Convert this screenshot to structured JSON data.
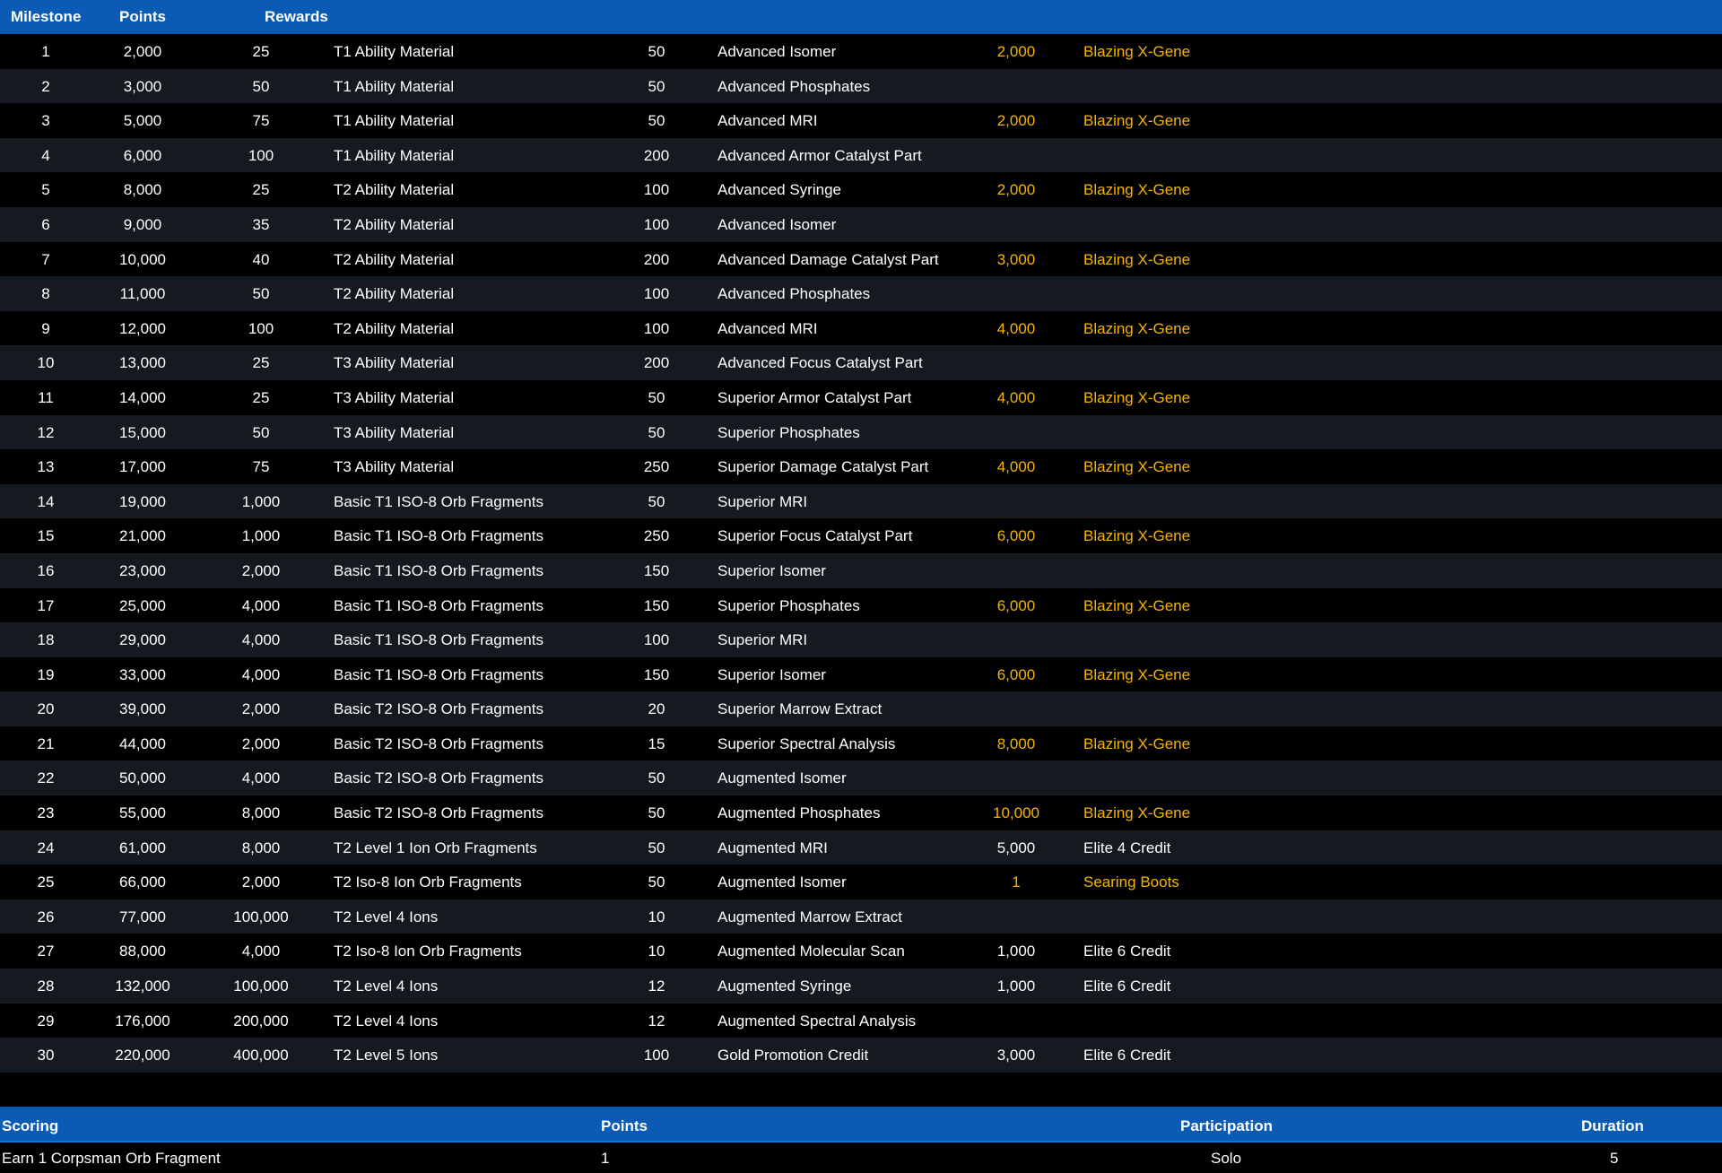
{
  "header": {
    "milestone": "Milestone",
    "points": "Points",
    "rewards": "Rewards"
  },
  "rows": [
    {
      "ms": "1",
      "pts": "2,000",
      "q1": "25",
      "n1": "T1 Ability Material",
      "q2": "50",
      "n2": "Advanced Isomer",
      "q3": "2,000",
      "n3": "Blazing X-Gene",
      "gold": true
    },
    {
      "ms": "2",
      "pts": "3,000",
      "q1": "50",
      "n1": "T1 Ability Material",
      "q2": "50",
      "n2": "Advanced Phosphates",
      "q3": "",
      "n3": "",
      "gold": false
    },
    {
      "ms": "3",
      "pts": "5,000",
      "q1": "75",
      "n1": "T1 Ability Material",
      "q2": "50",
      "n2": "Advanced MRI",
      "q3": "2,000",
      "n3": "Blazing X-Gene",
      "gold": true
    },
    {
      "ms": "4",
      "pts": "6,000",
      "q1": "100",
      "n1": "T1 Ability Material",
      "q2": "200",
      "n2": "Advanced Armor Catalyst Part",
      "q3": "",
      "n3": "",
      "gold": false
    },
    {
      "ms": "5",
      "pts": "8,000",
      "q1": "25",
      "n1": "T2 Ability Material",
      "q2": "100",
      "n2": "Advanced Syringe",
      "q3": "2,000",
      "n3": "Blazing X-Gene",
      "gold": true
    },
    {
      "ms": "6",
      "pts": "9,000",
      "q1": "35",
      "n1": "T2 Ability Material",
      "q2": "100",
      "n2": "Advanced Isomer",
      "q3": "",
      "n3": "",
      "gold": false
    },
    {
      "ms": "7",
      "pts": "10,000",
      "q1": "40",
      "n1": "T2 Ability Material",
      "q2": "200",
      "n2": "Advanced Damage Catalyst Part",
      "q3": "3,000",
      "n3": "Blazing X-Gene",
      "gold": true
    },
    {
      "ms": "8",
      "pts": "11,000",
      "q1": "50",
      "n1": "T2 Ability Material",
      "q2": "100",
      "n2": "Advanced Phosphates",
      "q3": "",
      "n3": "",
      "gold": false
    },
    {
      "ms": "9",
      "pts": "12,000",
      "q1": "100",
      "n1": "T2 Ability Material",
      "q2": "100",
      "n2": "Advanced MRI",
      "q3": "4,000",
      "n3": "Blazing X-Gene",
      "gold": true
    },
    {
      "ms": "10",
      "pts": "13,000",
      "q1": "25",
      "n1": "T3 Ability Material",
      "q2": "200",
      "n2": "Advanced Focus Catalyst Part",
      "q3": "",
      "n3": "",
      "gold": false
    },
    {
      "ms": "11",
      "pts": "14,000",
      "q1": "25",
      "n1": "T3 Ability Material",
      "q2": "50",
      "n2": "Superior Armor Catalyst Part",
      "q3": "4,000",
      "n3": "Blazing X-Gene",
      "gold": true
    },
    {
      "ms": "12",
      "pts": "15,000",
      "q1": "50",
      "n1": "T3 Ability Material",
      "q2": "50",
      "n2": "Superior Phosphates",
      "q3": "",
      "n3": "",
      "gold": false
    },
    {
      "ms": "13",
      "pts": "17,000",
      "q1": "75",
      "n1": "T3 Ability Material",
      "q2": "250",
      "n2": "Superior Damage Catalyst Part",
      "q3": "4,000",
      "n3": "Blazing X-Gene",
      "gold": true
    },
    {
      "ms": "14",
      "pts": "19,000",
      "q1": "1,000",
      "n1": "Basic T1 ISO-8 Orb Fragments",
      "q2": "50",
      "n2": "Superior MRI",
      "q3": "",
      "n3": "",
      "gold": false
    },
    {
      "ms": "15",
      "pts": "21,000",
      "q1": "1,000",
      "n1": "Basic T1 ISO-8 Orb Fragments",
      "q2": "250",
      "n2": "Superior Focus Catalyst Part",
      "q3": "6,000",
      "n3": "Blazing X-Gene",
      "gold": true
    },
    {
      "ms": "16",
      "pts": "23,000",
      "q1": "2,000",
      "n1": "Basic T1 ISO-8 Orb Fragments",
      "q2": "150",
      "n2": "Superior Isomer",
      "q3": "",
      "n3": "",
      "gold": false
    },
    {
      "ms": "17",
      "pts": "25,000",
      "q1": "4,000",
      "n1": "Basic T1 ISO-8 Orb Fragments",
      "q2": "150",
      "n2": "Superior Phosphates",
      "q3": "6,000",
      "n3": "Blazing X-Gene",
      "gold": true
    },
    {
      "ms": "18",
      "pts": "29,000",
      "q1": "4,000",
      "n1": "Basic T1 ISO-8 Orb Fragments",
      "q2": "100",
      "n2": "Superior MRI",
      "q3": "",
      "n3": "",
      "gold": false
    },
    {
      "ms": "19",
      "pts": "33,000",
      "q1": "4,000",
      "n1": "Basic T1 ISO-8 Orb Fragments",
      "q2": "150",
      "n2": "Superior Isomer",
      "q3": "6,000",
      "n3": "Blazing X-Gene",
      "gold": true
    },
    {
      "ms": "20",
      "pts": "39,000",
      "q1": "2,000",
      "n1": "Basic T2 ISO-8 Orb Fragments",
      "q2": "20",
      "n2": "Superior Marrow Extract",
      "q3": "",
      "n3": "",
      "gold": false
    },
    {
      "ms": "21",
      "pts": "44,000",
      "q1": "2,000",
      "n1": "Basic T2 ISO-8 Orb Fragments",
      "q2": "15",
      "n2": "Superior Spectral Analysis",
      "q3": "8,000",
      "n3": "Blazing X-Gene",
      "gold": true
    },
    {
      "ms": "22",
      "pts": "50,000",
      "q1": "4,000",
      "n1": "Basic T2 ISO-8 Orb Fragments",
      "q2": "50",
      "n2": "Augmented Isomer",
      "q3": "",
      "n3": "",
      "gold": false
    },
    {
      "ms": "23",
      "pts": "55,000",
      "q1": "8,000",
      "n1": "Basic T2 ISO-8 Orb Fragments",
      "q2": "50",
      "n2": "Augmented Phosphates",
      "q3": "10,000",
      "n3": "Blazing X-Gene",
      "gold": true
    },
    {
      "ms": "24",
      "pts": "61,000",
      "q1": "8,000",
      "n1": "T2 Level 1 Ion Orb Fragments",
      "q2": "50",
      "n2": "Augmented MRI",
      "q3": "5,000",
      "n3": "Elite 4 Credit",
      "gold": false
    },
    {
      "ms": "25",
      "pts": "66,000",
      "q1": "2,000",
      "n1": "T2 Iso-8 Ion Orb Fragments",
      "q2": "50",
      "n2": "Augmented Isomer",
      "q3": "1",
      "n3": "Searing Boots",
      "gold": true
    },
    {
      "ms": "26",
      "pts": "77,000",
      "q1": "100,000",
      "n1": "T2 Level 4 Ions",
      "q2": "10",
      "n2": "Augmented Marrow Extract",
      "q3": "",
      "n3": "",
      "gold": false
    },
    {
      "ms": "27",
      "pts": "88,000",
      "q1": "4,000",
      "n1": "T2 Iso-8 Ion Orb Fragments",
      "q2": "10",
      "n2": "Augmented Molecular Scan",
      "q3": "1,000",
      "n3": "Elite 6 Credit",
      "gold": false
    },
    {
      "ms": "28",
      "pts": "132,000",
      "q1": "100,000",
      "n1": "T2 Level 4 Ions",
      "q2": "12",
      "n2": "Augmented Syringe",
      "q3": "1,000",
      "n3": "Elite 6 Credit",
      "gold": false
    },
    {
      "ms": "29",
      "pts": "176,000",
      "q1": "200,000",
      "n1": "T2 Level 4 Ions",
      "q2": "12",
      "n2": "Augmented Spectral Analysis",
      "q3": "",
      "n3": "",
      "gold": false
    },
    {
      "ms": "30",
      "pts": "220,000",
      "q1": "400,000",
      "n1": "T2 Level 5 Ions",
      "q2": "100",
      "n2": "Gold Promotion Credit",
      "q3": "3,000",
      "n3": "Elite 6 Credit",
      "gold": false
    }
  ],
  "scoring": {
    "headers": {
      "scoring": "Scoring",
      "points": "Points",
      "participation": "Participation",
      "duration": "Duration"
    },
    "row": {
      "scoring": "Earn 1 Corpsman Orb Fragment",
      "points": "1",
      "participation": "Solo",
      "duration": "5"
    }
  },
  "colors": {
    "header_bg": "#0b5bb5",
    "row_dark": "#000000",
    "row_alt": "#151a20",
    "highlight": "#f6b400",
    "text": "#ffffff"
  }
}
